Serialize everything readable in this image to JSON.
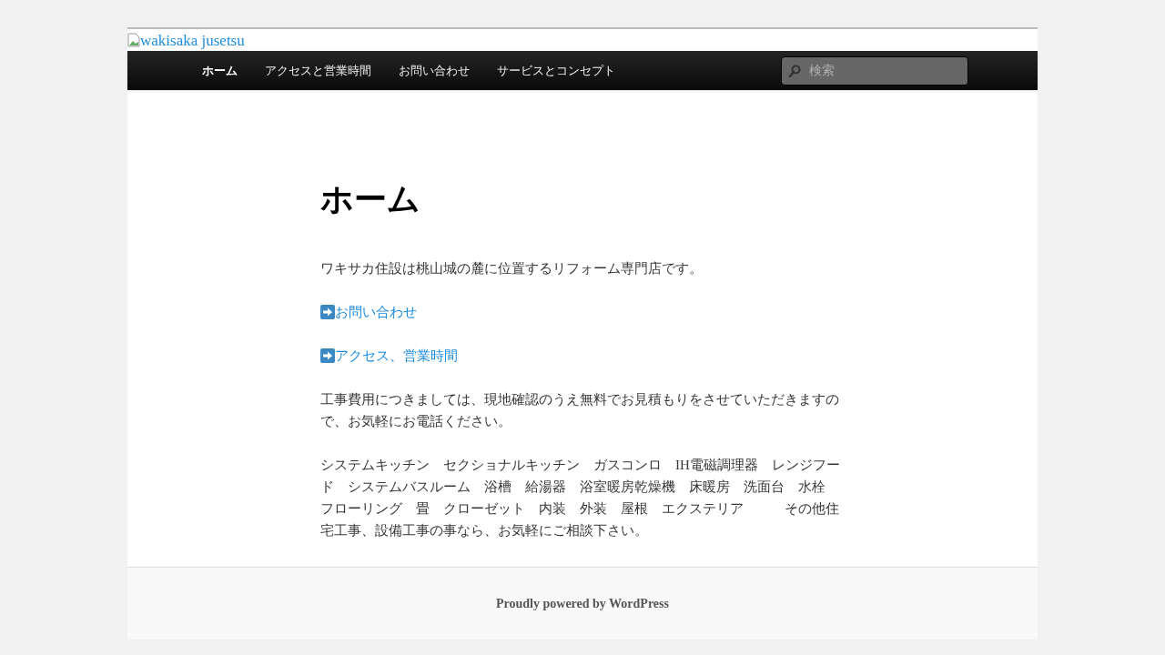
{
  "header": {
    "logo_alt": "wakisaka jusetsu"
  },
  "nav": {
    "items": [
      {
        "label": "ホーム",
        "selected": true
      },
      {
        "label": "アクセスと営業時間",
        "selected": false
      },
      {
        "label": "お問い合わせ",
        "selected": false
      },
      {
        "label": "サービスとコンセプト",
        "selected": false
      }
    ],
    "search": {
      "placeholder": "検索"
    }
  },
  "page": {
    "title": "ホーム",
    "blocks": [
      {
        "kind": "text",
        "text": "ワキサカ住設は桃山城の麓に位置するリフォーム専門店です。"
      },
      {
        "kind": "link",
        "text": "お問い合わせ"
      },
      {
        "kind": "link",
        "text": "アクセス、営業時間"
      },
      {
        "kind": "text",
        "text": "工事費用につきましては、現地確認のうえ無料でお見積もりをさせていただきますので、お気軽にお電話ください。"
      },
      {
        "kind": "lines",
        "lines": [
          "システムキッチン　セクショナルキッチン　ガスコンロ　IH電磁調理器　レンジフー",
          "ド　システムバスルーム　浴槽　給湯器　浴室暖房乾燥機　床暖房　洗面台　水栓",
          "フローリング　畳　クローゼット　内装　外装　屋根　エクステリア　　　その他住",
          "宅工事、設備工事の事なら、お気軽にご相談下さい。"
        ]
      }
    ]
  },
  "footer": {
    "credit": "Proudly powered by WordPress"
  }
}
